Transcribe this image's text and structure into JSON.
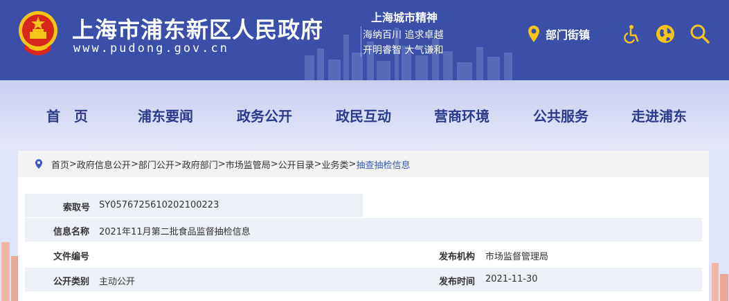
{
  "header": {
    "title": "上海市浦东新区人民政府",
    "url": "www.pudong.gov.cn",
    "spirit": {
      "title": "上海城市精神",
      "line1": "海纳百川  追求卓越",
      "line2": "开明睿智  大气谦和"
    },
    "dept_label": "部门街镇",
    "icons": [
      "location-pin-icon",
      "accessibility-icon",
      "globe-icon",
      "search-icon"
    ]
  },
  "nav": {
    "items": [
      "首　页",
      "浦东要闻",
      "政务公开",
      "政民互动",
      "营商环境",
      "公共服务",
      "走进浦东"
    ]
  },
  "breadcrumb": {
    "items": [
      "首页",
      "政府信息公开",
      "部门公开",
      "政府部门 ",
      " 市场监管局",
      "公开目录",
      "业务类"
    ],
    "current": "抽查抽检信息"
  },
  "info": {
    "index_label": "索取号",
    "index_value": "SY0576725610202100223",
    "name_label": "信息名称",
    "name_value": "2021年11月第二批食品监督抽检信息",
    "doc_label": "文件编号",
    "doc_value": "",
    "org_label": "发布机构",
    "org_value": "市场监督管理局",
    "type_label": "公开类别",
    "type_value": "主动公开",
    "date_label": "发布时间",
    "date_value": "2021-11-30"
  },
  "colors": {
    "header_bg": "#3b4fa8",
    "nav_text": "#2c3a8c",
    "accent_yellow": "#f5c518",
    "link_blue": "#3a5bb8"
  }
}
